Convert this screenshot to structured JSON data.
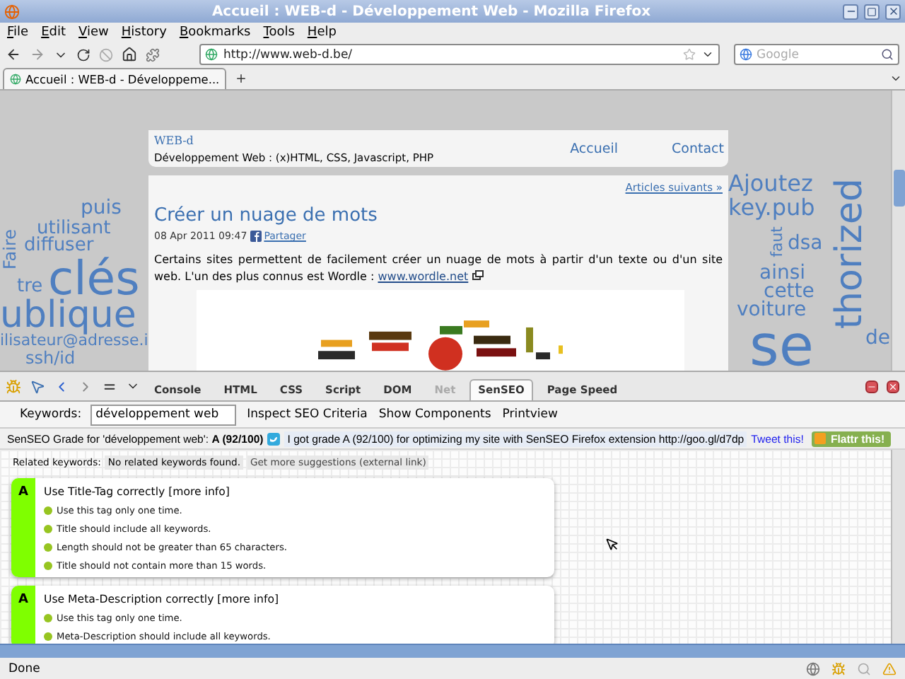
{
  "window": {
    "title": "Accueil : WEB-d - Développement Web - Mozilla Firefox"
  },
  "menu": [
    "File",
    "Edit",
    "View",
    "History",
    "Bookmarks",
    "Tools",
    "Help"
  ],
  "navigation": {
    "url": "http://www.web-d.be/",
    "search": {
      "placeholder": "Google"
    }
  },
  "tabs": [
    {
      "label": "Accueil : WEB-d - Développeme...",
      "selected": true
    }
  ],
  "page": {
    "site_name": "WEB-d",
    "tagline": "Développement Web : (x)HTML, CSS, Javascript, PHP",
    "nav_links": [
      "Accueil",
      "Contact"
    ],
    "next_link": "Articles suivants »",
    "article": {
      "title": "Créer un nuage de mots",
      "date": "08 Apr 2011 09:47",
      "share": "Partager",
      "text": "Certains sites permettent de facilement créer un nuage de mots à partir d'un texte ou d'un site web. L'un des plus connus est Wordle : ",
      "link": "www.wordle.net"
    },
    "cloud_words": [
      {
        "text": "puis",
        "kind": "horizontal"
      },
      {
        "text": "Faire",
        "kind": "vertical"
      },
      {
        "text": "utilisant",
        "kind": "horizontal"
      },
      {
        "text": "diffuser",
        "kind": "horizontal"
      },
      {
        "text": "tre",
        "kind": "horizontal"
      },
      {
        "text": "clés",
        "kind": "horizontal"
      },
      {
        "text": "ublique",
        "kind": "horizontal"
      },
      {
        "text": "ilisateur@adresse.i",
        "kind": "horizontal"
      },
      {
        "text": "ssh/id",
        "kind": "horizontal"
      },
      {
        "text": "Ajoutez",
        "kind": "horizontal"
      },
      {
        "text": "key.pub",
        "kind": "horizontal"
      },
      {
        "text": "faut",
        "kind": "vertical"
      },
      {
        "text": "dsa",
        "kind": "horizontal"
      },
      {
        "text": "ainsi",
        "kind": "horizontal"
      },
      {
        "text": "cette",
        "kind": "horizontal"
      },
      {
        "text": "voiture",
        "kind": "horizontal"
      },
      {
        "text": "se",
        "kind": "horizontal"
      },
      {
        "text": "thorized",
        "kind": "vertical"
      },
      {
        "text": "de",
        "kind": "horizontal"
      }
    ]
  },
  "devtools": {
    "tabs": [
      {
        "label": "Console",
        "selected": false,
        "disabled": false
      },
      {
        "label": "HTML",
        "selected": false,
        "disabled": false
      },
      {
        "label": "CSS",
        "selected": false,
        "disabled": false
      },
      {
        "label": "Script",
        "selected": false,
        "disabled": false
      },
      {
        "label": "DOM",
        "selected": false,
        "disabled": false
      },
      {
        "label": "Net",
        "selected": false,
        "disabled": true
      },
      {
        "label": "SenSEO",
        "selected": true,
        "disabled": false
      },
      {
        "label": "Page Speed",
        "selected": false,
        "disabled": false
      }
    ],
    "keywords_label": "Keywords:",
    "keywords_value": "développement web",
    "actions": [
      "Inspect SEO Criteria",
      "Show Components",
      "Printview"
    ],
    "grade": {
      "label": "SenSEO Grade for 'développement web': **A (92/100)**",
      "tweet_text": "I got grade A (92/100) for optimizing my site with SenSEO Firefox extension http://goo.gl/d7dp",
      "tweet_link": "Tweet this!",
      "flattr": "Flattr this!"
    },
    "related": {
      "label": "Related keywords:",
      "message": "No related keywords found.",
      "suggestion": "Get more suggestions (external link)"
    },
    "cards": [
      {
        "grade": "A",
        "title": "Use Title-Tag correctly",
        "more": "[more info]",
        "items": [
          "Use this tag only one time.",
          "Title should include all keywords.",
          "Length should not be greater than 65 characters.",
          "Title should not contain more than 15 words."
        ]
      },
      {
        "grade": "A",
        "title": "Use Meta-Description correctly",
        "more": "[more info]",
        "items": [
          "Use this tag only one time.",
          "Meta-Description should include all keywords."
        ]
      }
    ]
  },
  "status_bar": {
    "text": "Done"
  }
}
